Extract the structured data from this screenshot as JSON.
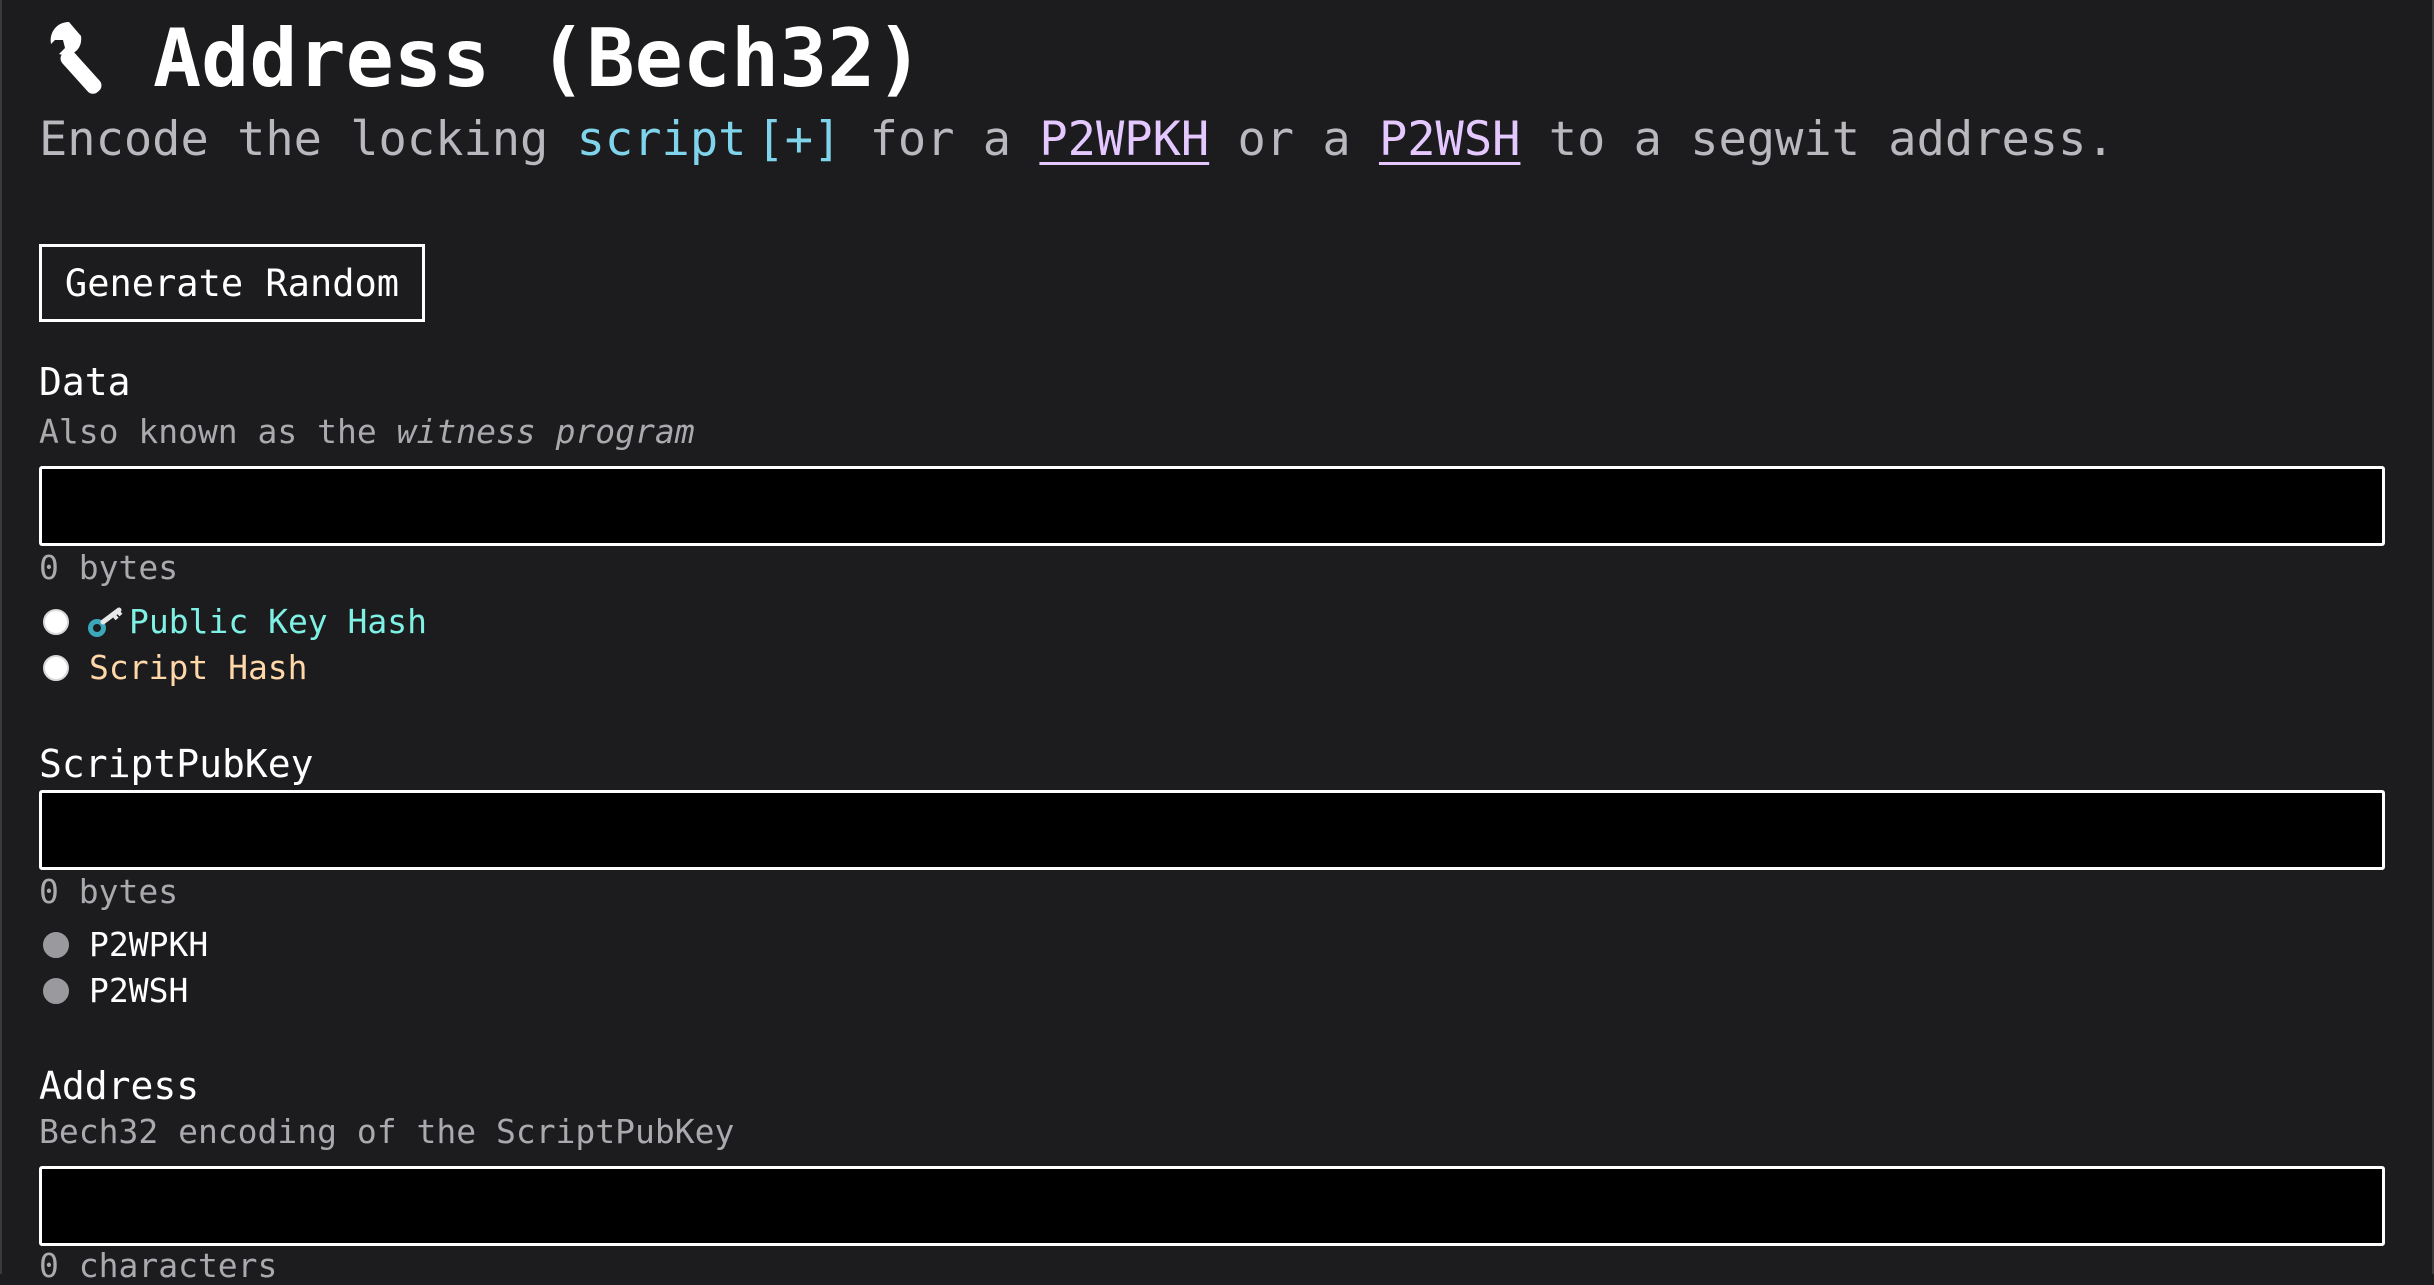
{
  "header": {
    "icon": "wrench-icon",
    "title": "Address (Bech32)"
  },
  "subtitle": {
    "prefix": "Encode the locking ",
    "script_link": "script",
    "script_expand": "[+]",
    "middle1": " for a ",
    "p2wpkh_link": "P2WPKH",
    "middle2": " or a ",
    "p2wsh_link": "P2WSH",
    "suffix": " to a segwit address."
  },
  "generate_button": {
    "label": "Generate Random"
  },
  "data_section": {
    "label": "Data",
    "hint_prefix": "Also known as the ",
    "hint_emphasis": "witness program",
    "value": "",
    "count": "0 bytes",
    "options": [
      {
        "label": "Public Key Hash",
        "icon": "key-icon",
        "color": "#7ff0e4"
      },
      {
        "label": "Script Hash",
        "color": "#ffd7a8"
      }
    ]
  },
  "scriptpubkey_section": {
    "label": "ScriptPubKey",
    "value": "",
    "count": "0 bytes",
    "options": [
      {
        "label": "P2WPKH"
      },
      {
        "label": "P2WSH"
      }
    ]
  },
  "address_section": {
    "label": "Address",
    "hint": "Bech32 encoding of the ScriptPubKey",
    "value": "",
    "count": "0 characters"
  },
  "colors": {
    "background": "#1c1c1e",
    "input_background": "#000000",
    "link_cyan": "#7fd3ea",
    "link_lavender": "#e4c8ff",
    "pkh_cyan": "#7ff0e4",
    "sh_peach": "#ffd7a8"
  }
}
